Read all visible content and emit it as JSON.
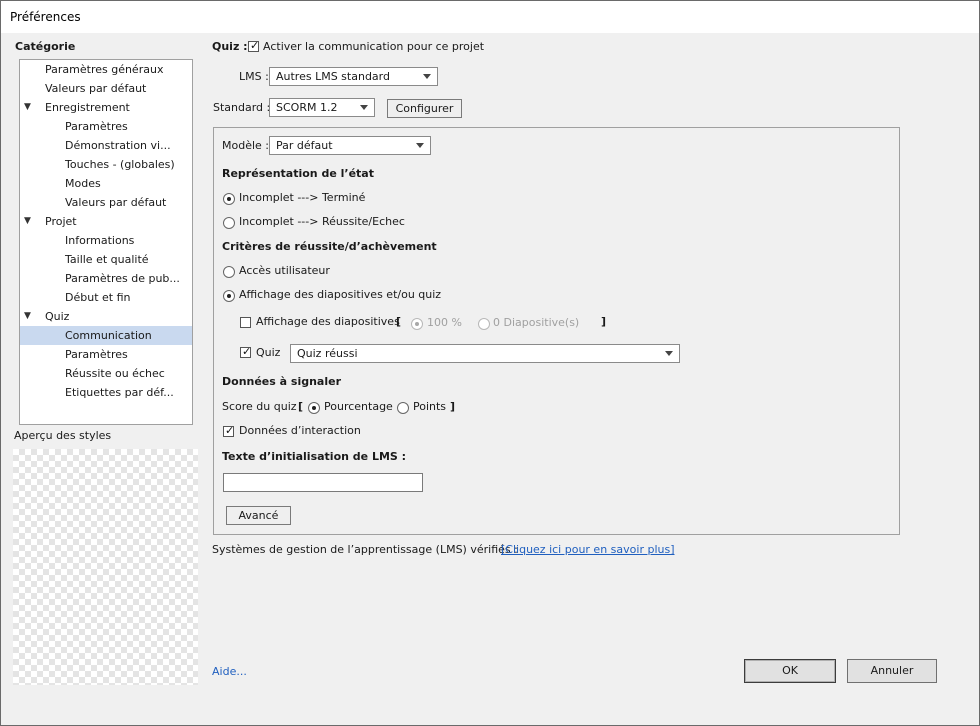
{
  "window": {
    "title": "Préférences"
  },
  "sidebar": {
    "heading": "Catégorie",
    "items": [
      {
        "label": "Paramètres généraux",
        "level": 1,
        "expand": ""
      },
      {
        "label": "Valeurs par défaut",
        "level": 1,
        "expand": ""
      },
      {
        "label": "Enregistrement",
        "level": 1,
        "expand": "▼"
      },
      {
        "label": "Paramètres",
        "level": 2,
        "expand": ""
      },
      {
        "label": "Démonstration vi...",
        "level": 2,
        "expand": ""
      },
      {
        "label": "Touches - (globales)",
        "level": 2,
        "expand": ""
      },
      {
        "label": "Modes",
        "level": 2,
        "expand": ""
      },
      {
        "label": "Valeurs par défaut",
        "level": 2,
        "expand": ""
      },
      {
        "label": "Projet",
        "level": 1,
        "expand": "▼"
      },
      {
        "label": "Informations",
        "level": 2,
        "expand": ""
      },
      {
        "label": "Taille et qualité",
        "level": 2,
        "expand": ""
      },
      {
        "label": "Paramètres de pub...",
        "level": 2,
        "expand": ""
      },
      {
        "label": "Début et fin",
        "level": 2,
        "expand": ""
      },
      {
        "label": "Quiz",
        "level": 1,
        "expand": "▼"
      },
      {
        "label": "Communication",
        "level": 2,
        "expand": "",
        "selected": true
      },
      {
        "label": "Paramètres",
        "level": 2,
        "expand": ""
      },
      {
        "label": "Réussite ou échec",
        "level": 2,
        "expand": ""
      },
      {
        "label": "Etiquettes par déf...",
        "level": 2,
        "expand": ""
      }
    ],
    "styles_preview_label": "Aperçu des styles"
  },
  "main": {
    "quiz_prefix": "Quiz :",
    "enable_comm_label": "Activer la communication pour ce projet",
    "lms_label": "LMS :",
    "lms_value": "Autres LMS standard",
    "standard_label": "Standard :",
    "standard_value": "SCORM 1.2",
    "configure_button": "Configurer",
    "model_label": "Modèle :",
    "model_value": "Par défaut",
    "status_heading": "Représentation de l’état",
    "status_opt1": "Incomplet ---> Terminé",
    "status_opt2": "Incomplet ---> Réussite/Echec",
    "criteria_heading": "Critères de réussite/d’achèvement",
    "crit_opt1": "Accès utilisateur",
    "crit_opt2": "Affichage des diapositives et/ou quiz",
    "slides_view_label": "Affichage des diapositives",
    "bracket_open": "[",
    "bracket_close": "]",
    "percent_label": "100 %",
    "slides_count_label": "0 Diapositive(s)",
    "quiz_check_label": "Quiz",
    "quiz_select_value": "Quiz réussi",
    "report_heading": "Données à signaler",
    "score_label": "Score du quiz",
    "score_percent": "Pourcentage",
    "score_points": "Points",
    "interaction_label": "Données d’interaction",
    "lms_init_heading": "Texte d’initialisation de LMS :",
    "lms_init_value": "",
    "advanced_button": "Avancé",
    "verified_text": "Systèmes de gestion de l’apprentissage (LMS) vérifiés :",
    "learn_more_link": "[Cliquez ici pour en savoir plus]"
  },
  "footer": {
    "help_link": "Aide...",
    "ok_button": "OK",
    "cancel_button": "Annuler"
  },
  "colors": {
    "selection": "#c9d9ef",
    "link": "#1f5fbf"
  }
}
